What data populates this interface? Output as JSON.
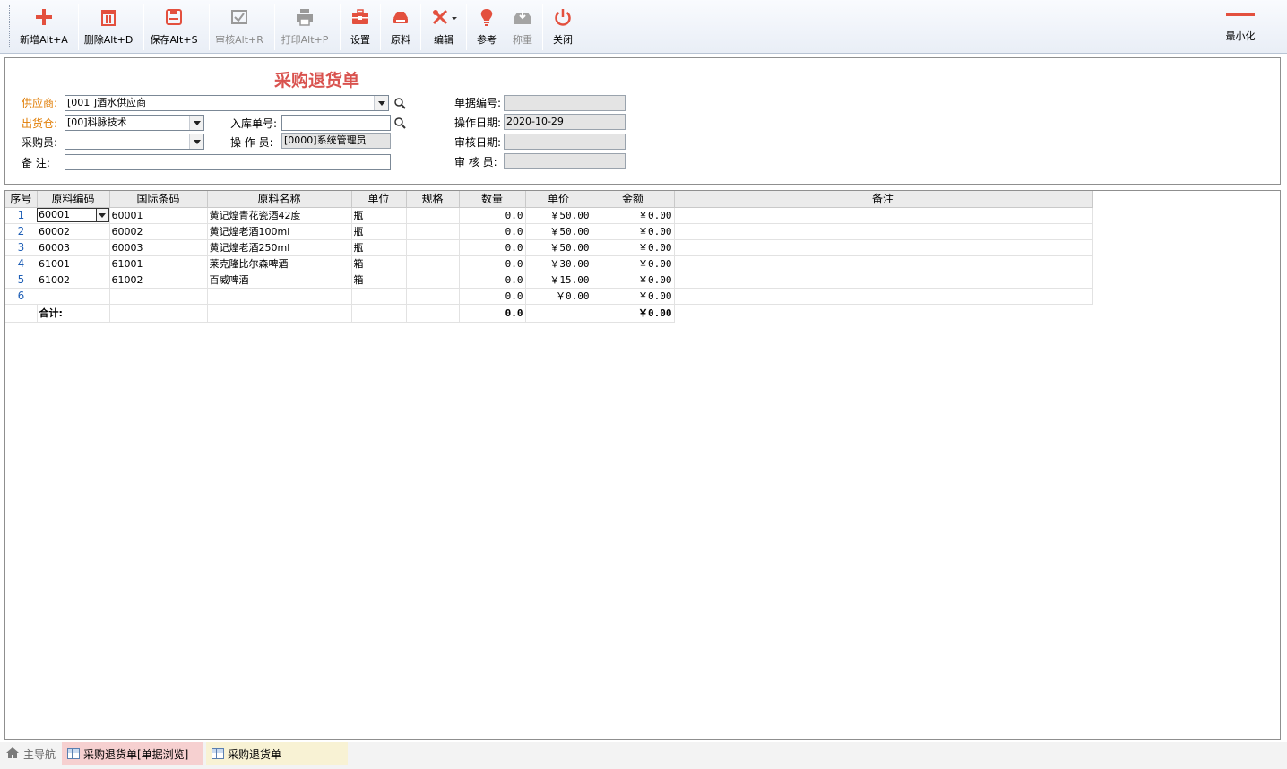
{
  "toolbar": {
    "buttons": [
      {
        "label": "新增Alt+A",
        "icon": "plus-icon",
        "enabled": true
      },
      {
        "label": "删除Alt+D",
        "icon": "trash-icon",
        "enabled": true
      },
      {
        "label": "保存Alt+S",
        "icon": "save-icon",
        "enabled": true
      },
      {
        "label": "审核Alt+R",
        "icon": "approve-icon",
        "enabled": false
      },
      {
        "label": "打印Alt+P",
        "icon": "printer-icon",
        "enabled": false
      },
      {
        "label": "设置",
        "icon": "toolbox-icon",
        "enabled": true
      },
      {
        "label": "原料",
        "icon": "material-icon",
        "enabled": true
      },
      {
        "label": "编辑",
        "icon": "edit-tools-icon",
        "enabled": true
      },
      {
        "label": "参考",
        "icon": "bulb-icon",
        "enabled": true
      },
      {
        "label": "称重",
        "icon": "scale-icon",
        "enabled": false
      },
      {
        "label": "关闭",
        "icon": "power-icon",
        "enabled": true
      }
    ],
    "minimize_label": "最小化",
    "accent_color": "#e3503e"
  },
  "form": {
    "title": "采购退货单",
    "supplier_label": "供应商:",
    "supplier_value": "[001      ]酒水供应商",
    "warehouse_label": "出货仓:",
    "warehouse_value": "[00]科脉技术",
    "buyer_label": "采购员:",
    "buyer_value": "",
    "remark_label": "备  注:",
    "remark_value": "",
    "inbound_no_label": "入库单号:",
    "inbound_no_value": "",
    "operator_label": "操 作 员:",
    "operator_value": "[0000]系统管理员",
    "doc_no_label": "单据编号:",
    "doc_no_value": "",
    "op_date_label": "操作日期:",
    "op_date_value": "2020-10-29",
    "audit_date_label": "审核日期:",
    "audit_date_value": "",
    "auditor_label": "审 核 员:",
    "auditor_value": ""
  },
  "grid": {
    "columns": [
      "序号",
      "原料编码",
      "国际条码",
      "原料名称",
      "单位",
      "规格",
      "数量",
      "单价",
      "金额",
      "备注"
    ],
    "rows": [
      {
        "no": "1",
        "code": "60001",
        "barcode": "60001",
        "name": "黄记煌青花瓷酒42度",
        "unit": "瓶",
        "spec": "",
        "qty": "0.0",
        "price": "￥50.00",
        "amount": "￥0.00",
        "remark": ""
      },
      {
        "no": "2",
        "code": "60002",
        "barcode": "60002",
        "name": "黄记煌老酒100ml",
        "unit": "瓶",
        "spec": "",
        "qty": "0.0",
        "price": "￥50.00",
        "amount": "￥0.00",
        "remark": ""
      },
      {
        "no": "3",
        "code": "60003",
        "barcode": "60003",
        "name": "黄记煌老酒250ml",
        "unit": "瓶",
        "spec": "",
        "qty": "0.0",
        "price": "￥50.00",
        "amount": "￥0.00",
        "remark": ""
      },
      {
        "no": "4",
        "code": "61001",
        "barcode": "61001",
        "name": "莱克隆比尔森啤酒",
        "unit": "箱",
        "spec": "",
        "qty": "0.0",
        "price": "￥30.00",
        "amount": "￥0.00",
        "remark": ""
      },
      {
        "no": "5",
        "code": "61002",
        "barcode": "61002",
        "name": "百威啤酒",
        "unit": "箱",
        "spec": "",
        "qty": "0.0",
        "price": "￥15.00",
        "amount": "￥0.00",
        "remark": ""
      },
      {
        "no": "6",
        "code": "",
        "barcode": "",
        "name": "",
        "unit": "",
        "spec": "",
        "qty": "0.0",
        "price": "￥0.00",
        "amount": "￥0.00",
        "remark": ""
      }
    ],
    "total": {
      "label": "合计:",
      "qty": "0.0",
      "amount": "￥0.00"
    }
  },
  "statusbar": {
    "tabs": [
      {
        "label": "主导航",
        "icon": "home-icon"
      },
      {
        "label": "采购退货单[单据浏览]",
        "icon": "grid-icon"
      },
      {
        "label": "采购退货单",
        "icon": "grid-icon"
      }
    ]
  }
}
